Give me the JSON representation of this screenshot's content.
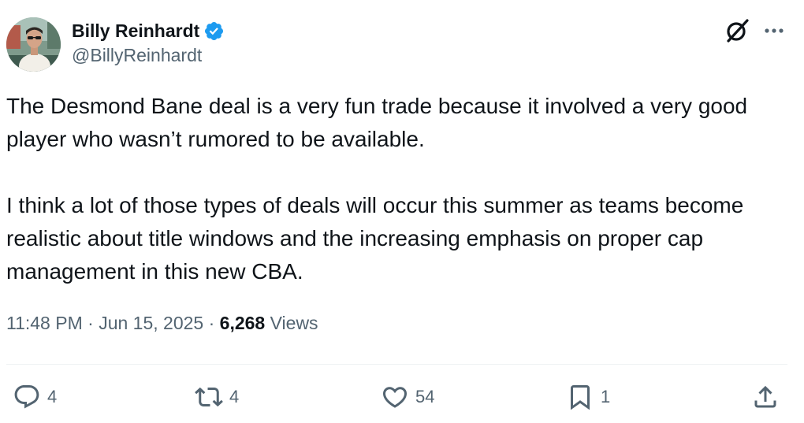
{
  "author": {
    "display_name": "Billy Reinhardt",
    "handle": "@BillyReinhardt",
    "verified": true
  },
  "tweet": {
    "paragraphs": [
      "The Desmond Bane deal is a very fun trade because it involved a very good player who wasn’t rumored to be available.",
      "I think a lot of those types of deals will occur this summer as teams become realistic about title windows and the increasing emphasis on proper cap management in this new CBA."
    ],
    "time": "11:48 PM",
    "date": "Jun 15, 2025",
    "views_count": "6,268",
    "views_label": "Views",
    "separator": "·"
  },
  "actions": {
    "reply_count": "4",
    "repost_count": "4",
    "like_count": "54",
    "bookmark_count": "1"
  },
  "icons": {
    "verified": "verified-badge-icon",
    "grok": "grok-icon",
    "more": "more-dots-icon",
    "reply": "reply-icon",
    "repost": "repost-icon",
    "like": "heart-icon",
    "bookmark": "bookmark-icon",
    "share": "share-icon"
  },
  "colors": {
    "text": "#0f1419",
    "muted": "#536471",
    "verified_blue": "#1d9bf0",
    "divider": "#eff3f4"
  }
}
